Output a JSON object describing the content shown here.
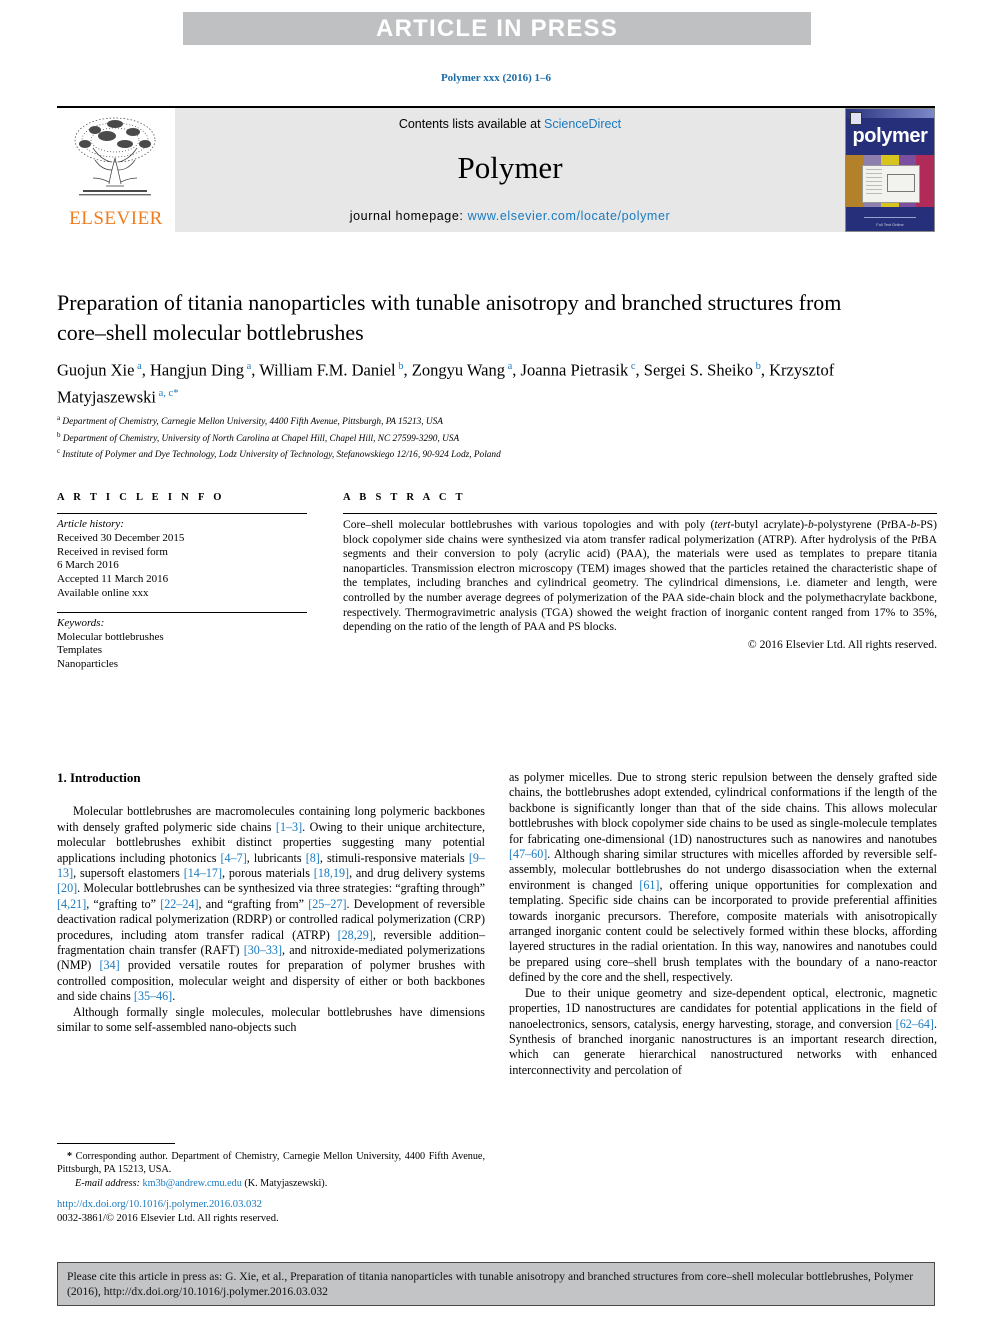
{
  "banner": {
    "text": "ARTICLE IN PRESS"
  },
  "running_head": "Polymer xxx (2016) 1–6",
  "masthead": {
    "contents_prefix": "Contents lists available at ",
    "contents_link": "ScienceDirect",
    "journal_title": "Polymer",
    "homepage_label": "journal homepage: ",
    "homepage_url": "www.elsevier.com/locate/polymer",
    "publisher": "ELSEVIER",
    "cover_word": "polymer",
    "cover_footer": "Full Text Online"
  },
  "article": {
    "title": "Preparation of titania nanoparticles with tunable anisotropy and branched structures from core–shell molecular bottlebrushes",
    "authors": [
      {
        "name": "Guojun Xie",
        "sup": "a",
        "sep": ", "
      },
      {
        "name": "Hangjun Ding",
        "sup": "a",
        "sep": ", "
      },
      {
        "name": "William F.M. Daniel",
        "sup": "b",
        "sep": ", "
      },
      {
        "name": "Zongyu Wang",
        "sup": "a",
        "sep": ", "
      },
      {
        "name": "Joanna Pietrasik",
        "sup": "c",
        "sep": ", "
      },
      {
        "name": "Sergei S. Sheiko",
        "sup": "b",
        "sep": ", "
      },
      {
        "name": "Krzysztof Matyjaszewski",
        "sup": "a, c",
        "star": "*",
        "sep": ""
      }
    ],
    "affiliations": [
      {
        "mark": "a",
        "text": "Department of Chemistry, Carnegie Mellon University, 4400 Fifth Avenue, Pittsburgh, PA 15213, USA"
      },
      {
        "mark": "b",
        "text": "Department of Chemistry, University of North Carolina at Chapel Hill, Chapel Hill, NC 27599-3290, USA"
      },
      {
        "mark": "c",
        "text": "Institute of Polymer and Dye Technology, Lodz University of Technology, Stefanowskiego 12/16, 90-924 Lodz, Poland"
      }
    ]
  },
  "article_info": {
    "heading": "A R T I C L E   I N F O",
    "history_label": "Article history:",
    "history": [
      "Received 30 December 2015",
      "Received in revised form",
      "6 March 2016",
      "Accepted 11 March 2016",
      "Available online xxx"
    ],
    "keywords_label": "Keywords:",
    "keywords": [
      "Molecular bottlebrushes",
      "Templates",
      "Nanoparticles"
    ]
  },
  "abstract": {
    "heading": "A B S T R A C T",
    "body_html": "Core–shell molecular bottlebrushes with various topologies and with poly (<i>tert</i>-butyl acrylate)-<i>b</i>-polystyrene (P<i>t</i>BA-<i>b</i>-PS) block copolymer side chains were synthesized via atom transfer radical polymerization (ATRP). After hydrolysis of the P<i>t</i>BA segments and their conversion to poly (acrylic acid) (PAA), the materials were used as templates to prepare titania nanoparticles. Transmission electron microscopy (TEM) images showed that the particles retained the characteristic shape of the templates, including branches and cylindrical geometry. The cylindrical dimensions, i.e. diameter and length, were controlled by the number average degrees of polymerization of the PAA side-chain block and the polymethacrylate backbone, respectively. Thermogravimetric analysis (TGA) showed the weight fraction of inorganic content ranged from 17% to 35%, depending on the ratio of the length of PAA and PS blocks.",
    "copyright": "© 2016 Elsevier Ltd. All rights reserved."
  },
  "body": {
    "section_heading": "1.  Introduction",
    "left_paragraphs_html": [
      "Molecular bottlebrushes are macromolecules containing long polymeric backbones with densely grafted polymeric side chains <span class=\"ref\">[1–3]</span>. Owing to their unique architecture, molecular bottlebrushes exhibit distinct properties suggesting many potential applications including photonics <span class=\"ref\">[4–7]</span>, lubricants <span class=\"ref\">[8]</span>, stimuli-responsive materials <span class=\"ref\">[9–13]</span>, supersoft elastomers <span class=\"ref\">[14–17]</span>, porous materials <span class=\"ref\">[18,19]</span>, and drug delivery systems <span class=\"ref\">[20]</span>. Molecular bottlebrushes can be synthesized via three strategies: “grafting through” <span class=\"ref\">[4,21]</span>, “grafting to” <span class=\"ref\">[22–24]</span>, and “grafting from” <span class=\"ref\">[25–27]</span>. Development of reversible deactivation radical polymerization (RDRP) or controlled radical polymerization (CRP) procedures, including atom transfer radical (ATRP) <span class=\"ref\">[28,29]</span>, reversible addition–fragmentation chain transfer (RAFT) <span class=\"ref\">[30–33]</span>, and nitroxide-mediated polymerizations (NMP) <span class=\"ref\">[34]</span> provided versatile routes for preparation of polymer brushes with controlled composition, molecular weight and dispersity of either or both backbones and side chains <span class=\"ref\">[35–46]</span>.",
      "Although formally single molecules, molecular bottlebrushes have dimensions similar to some self-assembled nano-objects such"
    ],
    "right_paragraphs_html": [
      "as polymer micelles. Due to strong steric repulsion between the densely grafted side chains, the bottlebrushes adopt extended, cylindrical conformations if the length of the backbone is significantly longer than that of the side chains. This allows molecular bottlebrushes with block copolymer side chains to be used as single-molecule templates for fabricating one-dimensional (1D) nanostructures such as nanowires and nanotubes <span class=\"ref\">[47–60]</span>. Although sharing similar structures with micelles afforded by reversible self-assembly, molecular bottlebrushes do not undergo disassociation when the external environment is changed <span class=\"ref\">[61]</span>, offering unique opportunities for complexation and templating. Specific side chains can be incorporated to provide preferential affinities towards inorganic precursors. Therefore, composite materials with anisotropically arranged inorganic content could be selectively formed within these blocks, affording layered structures in the radial orientation. In this way, nanowires and nanotubes could be prepared using core–shell brush templates with the boundary of a nano-reactor defined by the core and the shell, respectively.",
      "Due to their unique geometry and size-dependent optical, electronic, magnetic properties, 1D nanostructures are candidates for potential applications in the field of nanoelectronics, sensors, catalysis, energy harvesting, storage, and conversion <span class=\"ref\">[62–64]</span>. Synthesis of branched inorganic nanostructures is an important research direction, which can generate hierarchical nanostructured networks with enhanced interconnectivity and percolation of"
    ]
  },
  "footnotes": {
    "corresponding_html": "<b>*</b> Corresponding author. Department of Chemistry, Carnegie Mellon University, 4400 Fifth Avenue, Pittsburgh, PA 15213, USA.",
    "email_label": "E-mail address:",
    "email": "km3b@andrew.cmu.edu",
    "email_owner": "(K. Matyjaszewski)."
  },
  "doi_block": {
    "doi_url": "http://dx.doi.org/10.1016/j.polymer.2016.03.032",
    "issn_line": "0032-3861/© 2016 Elsevier Ltd. All rights reserved."
  },
  "citation_footer": {
    "text": "Please cite this article in press as: G. Xie, et al., Preparation of titania nanoparticles with tunable anisotropy and branched structures from core–shell molecular bottlebrushes, Polymer (2016), http://dx.doi.org/10.1016/j.polymer.2016.03.032"
  },
  "colors": {
    "link_blue": "#1a7abf",
    "banner_gray": "#bfc0c2",
    "masthead_gray": "#e7e7e7",
    "footer_gray": "#c3c4c6",
    "elsevier_orange": "#f07c1d"
  }
}
